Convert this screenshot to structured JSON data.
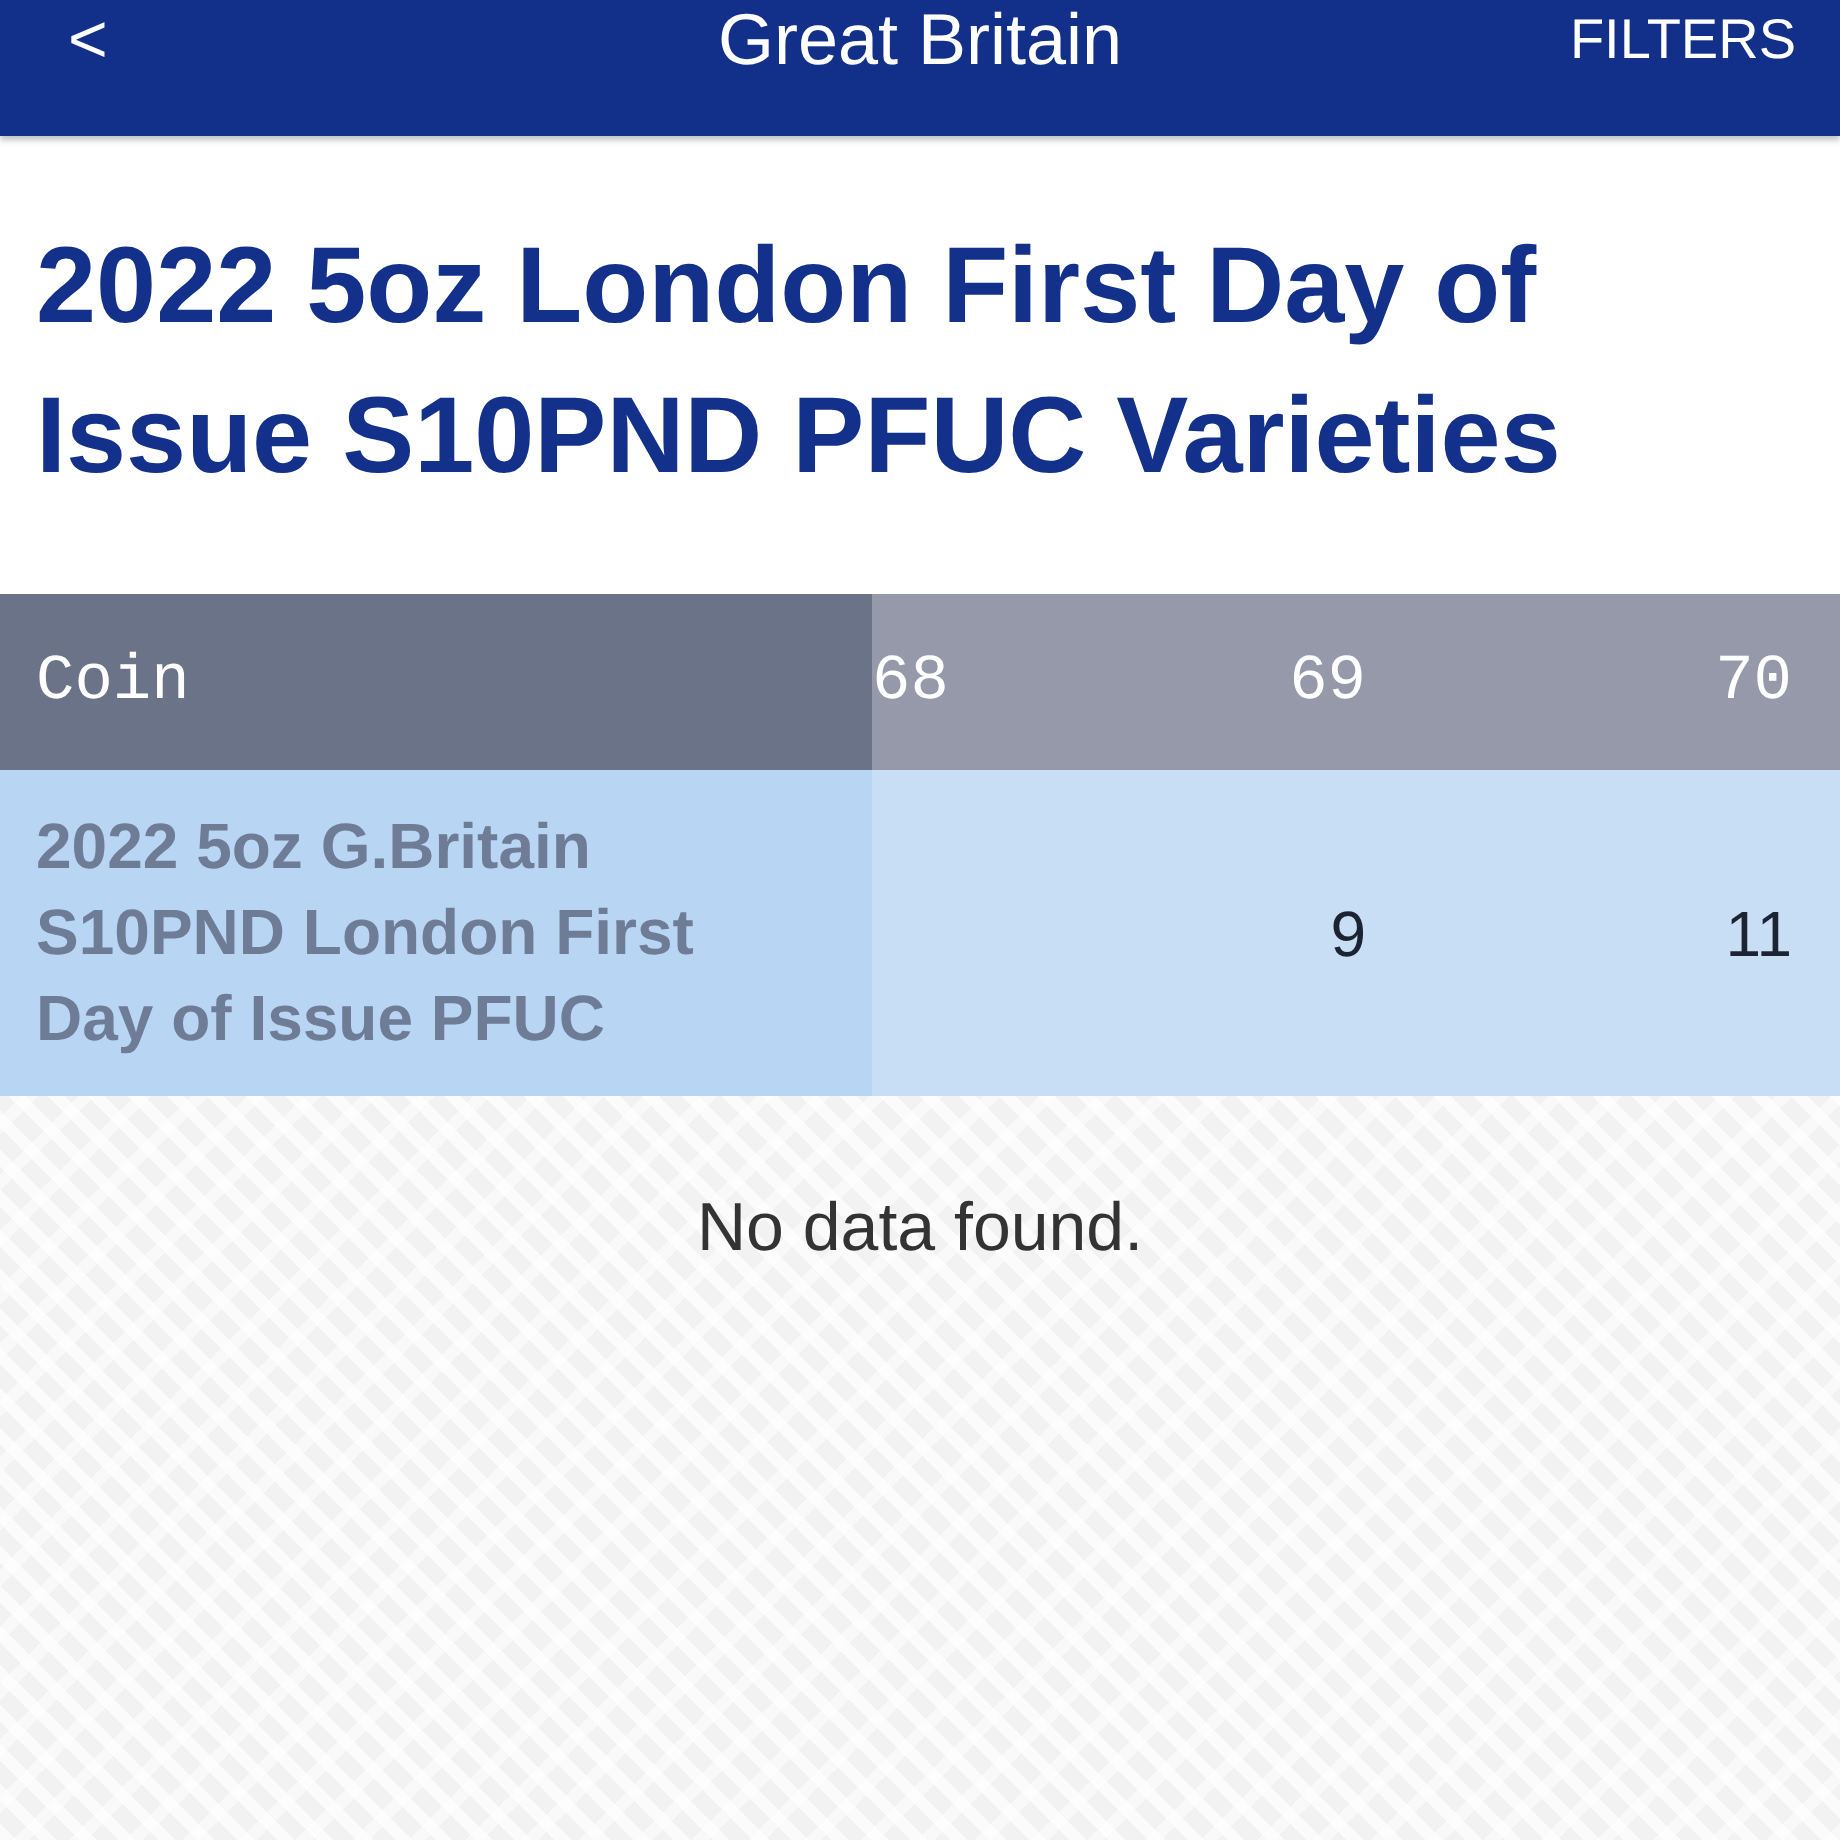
{
  "header": {
    "back": "<",
    "title": "Great Britain",
    "action": "FILTERS"
  },
  "heading": "2022 5oz London First Day of Issue S10PND PFUC Varieties",
  "table": {
    "columns": [
      "Coin",
      "68",
      "69",
      "70"
    ],
    "rows": [
      {
        "cells": [
          "2022 5oz G.Britain S10PND London First Day of Issue PFUC",
          "",
          "9",
          "11"
        ]
      }
    ]
  },
  "empty_message": "No data found."
}
